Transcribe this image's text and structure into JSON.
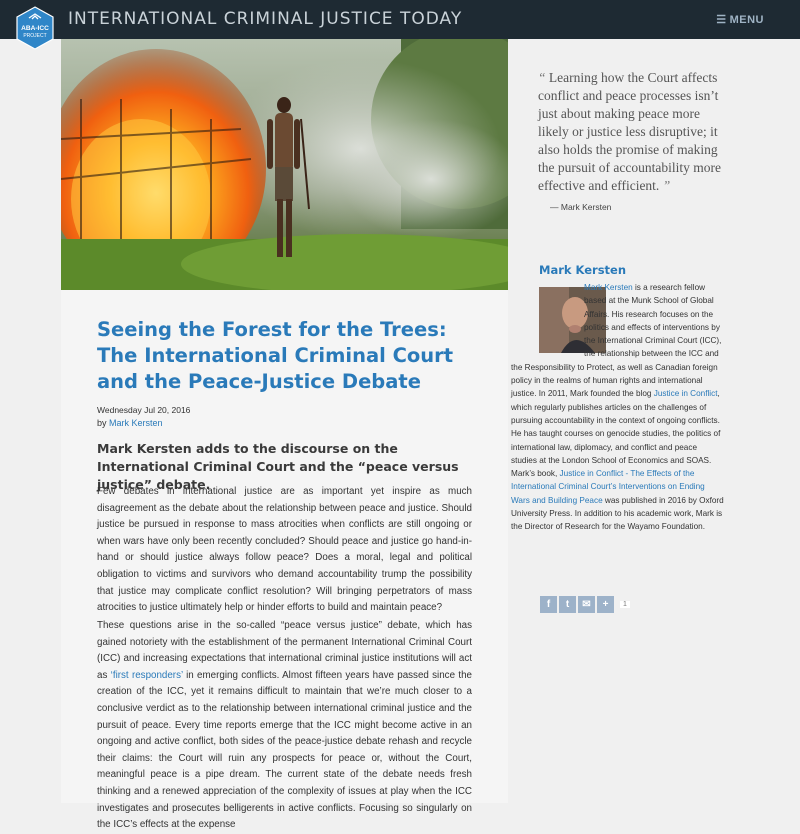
{
  "header": {
    "logo_line1": "ABA-ICC",
    "logo_line2": "PROJECT",
    "site_title": "INTERNATIONAL CRIMINAL JUSTICE TODAY",
    "menu_icon": "hamburger-icon",
    "menu_label": "MENU"
  },
  "article": {
    "title": "Seeing the Forest for the Trees: The International Criminal Court and the Peace-Justice Debate",
    "date": "Wednesday Jul 20, 2016",
    "by_prefix": "by",
    "author": "Mark Kersten",
    "lede": "Mark Kersten adds to the discourse on the International Criminal Court and the “peace versus justice” debate.",
    "p1": "Few debates in international justice are as important yet inspire as much disagreement as the debate about the relationship between peace and justice. Should justice be pursued in response to mass atrocities when conflicts are still ongoing or when wars have only been recently concluded? Should peace and justice go hand-in-hand or should justice always follow peace? Does a moral, legal and political obligation to victims and survivors who demand accountability trump the possibility that justice may complicate conflict resolution? Will bringing perpetrators of mass atrocities to justice ultimately help or hinder efforts to build and maintain peace?",
    "p2_a": "These questions arise in the so-called “peace versus justice” debate, which has gained notoriety with the establishment of the permanent International Criminal Court (ICC) and increasing expectations that international criminal justice institutions will act as ",
    "p2_link": "‘first responders’",
    "p2_b": " in emerging conflicts. Almost fifteen years have passed since the creation of the ICC, yet it remains difficult to maintain that we’re much closer to a conclusive verdict as to the relationship between international criminal justice and the pursuit of peace. Every time reports emerge that the ICC might become active in an ongoing and active conflict, both sides of the peace-justice debate rehash and recycle their claims: the Court will ruin any prospects for peace or, without the Court, meaningful peace is a pipe dream. The current state of the debate needs fresh thinking and a renewed appreciation of the complexity of issues at play when the ICC investigates and prosecutes belligerents in active conflicts. Focusing so singularly on the ICC’s effects at the expense"
  },
  "sidebar": {
    "quote_open": "“",
    "quote_text": "Learning how the Court affects conflict and peace processes isn’t just about making peace more likely or justice less disruptive; it also holds the promise of making the pursuit of accountability more effective and efficient.",
    "quote_close": "”",
    "quote_attribution": "— Mark Kersten",
    "bio_heading": "Mark Kersten",
    "bio_name_link": "Mark Kersten",
    "bio_1": " is a research fellow based at the Munk School of Global Affairs. His research focuses on the politics and effects of interventions by the International Criminal Court (ICC), the relationship between the ICC and the Responsibility to Protect, as well as Canadian foreign policy in the realms of human rights and international justice. In 2011, Mark founded the blog ",
    "bio_blog_link": "Justice in Conflict",
    "bio_2": ", which regularly publishes articles on the challenges of pursuing accountability in the context of ongoing conflicts. He has taught courses on genocide studies, the politics of international law, diplomacy, and conflict and peace studies at the London School of Economics and SOAS. Mark’s book, ",
    "bio_book_link": "Justice in Conflict - The Effects of the International Criminal Court’s Interventions on Ending Wars and Building Peace",
    "bio_3": " was published in 2016 by Oxford University Press. In addition to his academic work, Mark is the Director of Research for the Wayamo Foundation.",
    "share_buttons": [
      {
        "icon": "facebook-icon",
        "glyph": "f"
      },
      {
        "icon": "twitter-icon",
        "glyph": "t"
      },
      {
        "icon": "email-icon",
        "glyph": "✉"
      },
      {
        "icon": "plus-share-icon",
        "glyph": "+"
      }
    ],
    "share_count": "1"
  },
  "colors": {
    "topbar": "#1e2a33",
    "accent_blue": "#2a7ab9",
    "logo_blue": "#2f86c8",
    "share_button": "#9db2c9"
  }
}
